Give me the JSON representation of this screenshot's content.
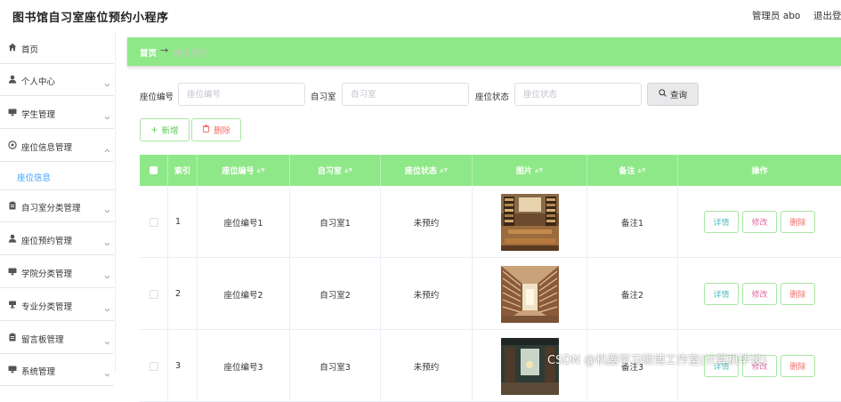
{
  "header": {
    "title": "图书馆自习室座位预约小程序",
    "admin": "管理员 abo",
    "logout": "退出登"
  },
  "sidebar": {
    "items": [
      {
        "label": "首页",
        "icon": "home-icon"
      },
      {
        "label": "个人中心",
        "icon": "user-icon"
      },
      {
        "label": "学生管理",
        "icon": "monitor-icon"
      },
      {
        "label": "座位信息管理",
        "icon": "gear-icon"
      },
      {
        "label": "座位信息",
        "icon": ""
      },
      {
        "label": "自习室分类管理",
        "icon": "clipboard-icon"
      },
      {
        "label": "座位预约管理",
        "icon": "user-icon"
      },
      {
        "label": "学院分类管理",
        "icon": "monitor-icon"
      },
      {
        "label": "专业分类管理",
        "icon": "cup-icon"
      },
      {
        "label": "留言板管理",
        "icon": "clipboard-icon"
      },
      {
        "label": "系统管理",
        "icon": "monitor-icon"
      }
    ]
  },
  "breadcrumb": {
    "home": "首页",
    "arrow": "→",
    "current": "座位信息"
  },
  "search": {
    "seat_no_label": "座位编号",
    "seat_no_placeholder": "座位编号",
    "room_label": "自习室",
    "room_placeholder": "自习室",
    "status_label": "座位状态",
    "status_placeholder": "座位状态",
    "query_label": "查询"
  },
  "actions": {
    "add_label": "新增",
    "delete_label": "删除"
  },
  "table": {
    "columns": [
      "索引",
      "座位编号",
      "自习室",
      "座位状态",
      "图片",
      "备注",
      "操作"
    ],
    "rows": [
      {
        "index": "1",
        "seat_no": "座位编号1",
        "room": "自习室1",
        "status": "未预约",
        "image": "library-reading-room",
        "note": "备注1"
      },
      {
        "index": "2",
        "seat_no": "座位编号2",
        "room": "自习室2",
        "status": "未预约",
        "image": "library-atrium",
        "note": "备注2"
      },
      {
        "index": "3",
        "seat_no": "座位编号3",
        "room": "自习室3",
        "status": "未预约",
        "image": "library-hall",
        "note": "备注3"
      }
    ],
    "row_actions": {
      "detail": "详情",
      "edit": "修改",
      "delete": "删除"
    }
  },
  "watermark": "CSDN @机器学习硕博工作室(计算机毕设)",
  "colors": {
    "accent_green": "#8fe888",
    "link_blue": "#3aa0ff",
    "danger": "#f56c6c"
  }
}
